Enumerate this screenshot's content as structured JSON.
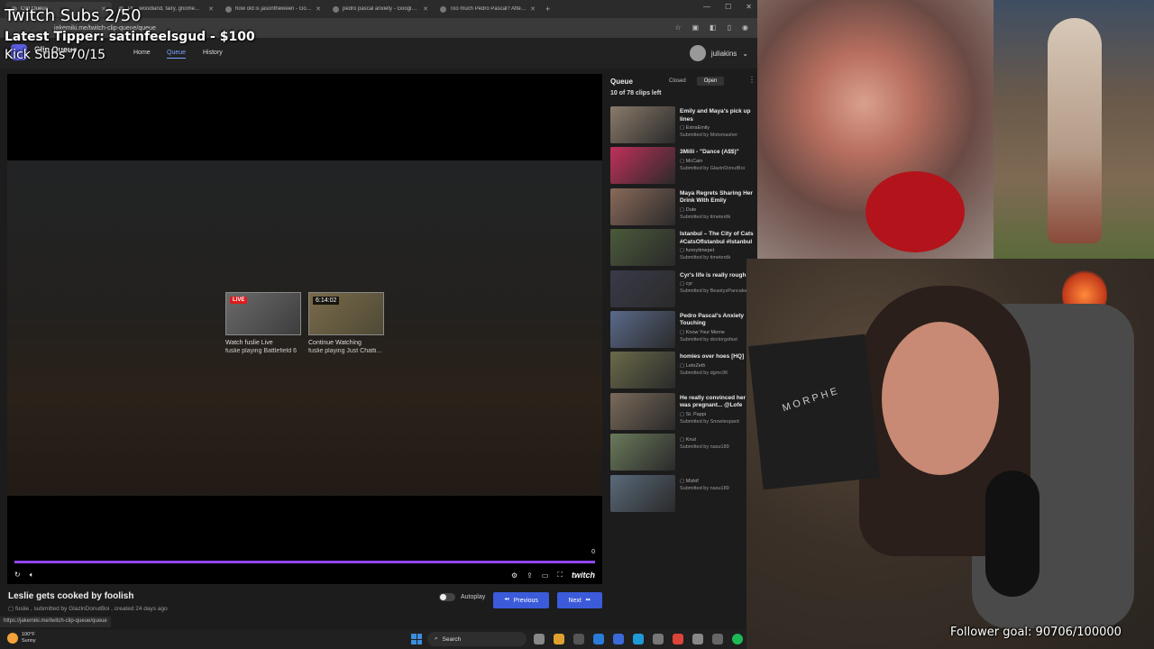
{
  "browser": {
    "tabs": [
      {
        "title": "Clip Queue",
        "active": true
      },
      {
        "title": "Pr... woodland, fairy, gnome...",
        "active": false
      },
      {
        "title": "how old is jasontheween - Goo...",
        "active": false
      },
      {
        "title": "pedro pascal anxiety - Google ...",
        "active": false
      },
      {
        "title": "Too much Pedro Pascal? After ...",
        "active": false
      }
    ],
    "new_tab": "+",
    "url": "jakemiki.me/twitch-clip-queue/queue"
  },
  "app": {
    "brand": "Clip Queue",
    "nav": {
      "home": "Home",
      "queue": "Queue",
      "history": "History"
    },
    "user": "juliakins"
  },
  "player": {
    "endcards": [
      {
        "badge": "LIVE",
        "title": "Watch fuslie Live",
        "subtitle": "fuslie playing Battlefield 6"
      },
      {
        "badge": "6:14:02",
        "title": "Continue Watching",
        "subtitle": "fuslie playing Just Chatti..."
      }
    ],
    "time": "0",
    "progress": 1.0,
    "brand": "twitch"
  },
  "clip": {
    "title": "Leslie gets cooked by foolish",
    "meta": "fuslie , submitted by GlazinDonutBoi , created 24 days ago"
  },
  "controls": {
    "autoplay": "Autoplay",
    "previous": "Previous",
    "next": "Next"
  },
  "status_url": "https://jakemiki.me/twitch-clip-queue/queue",
  "queue": {
    "heading": "Queue",
    "closed": "Closed",
    "open": "Open",
    "count": "10 of 78 clips left",
    "items": [
      {
        "title": "Emily and Maya's pick up lines",
        "channel": "ExtraEmily",
        "submitter": "Submitted by Motomasher",
        "color": "#8a7a6a"
      },
      {
        "title": "3Milli - \"Dance (A$$)\"",
        "channel": "McCain",
        "submitter": "Submitted by GlazinDonutBoi",
        "color": "#c0305a"
      },
      {
        "title": "Maya Regrets Sharing Her Drink With Emily",
        "channel": "Dute",
        "submitter": "Submitted by timeterdk",
        "color": "#8a6a5a"
      },
      {
        "title": "Istanbul – The City of Cats #CatsOfIstanbul #Istanbul",
        "channel": "funnytimepet",
        "submitter": "Submitted by timeterdk",
        "color": "#4a5a3a"
      },
      {
        "title": "Cyr's life is really rough",
        "channel": "cyr",
        "submitter": "Submitted by BeastyxPancakes",
        "color": "#3a3a4a"
      },
      {
        "title": "Pedro Pascal's Anxiety Touching",
        "channel": "Know Your Meme",
        "submitter": "Submitted by doctorgofast",
        "color": "#5a6a8a"
      },
      {
        "title": "homies over hoes [HQ]",
        "channel": "LetoZeth",
        "submitter": "Submitted by dgmc96",
        "color": "#6a6a4a"
      },
      {
        "title": "He really convinced her she was pregnant... @Lofe",
        "channel": "St. Pappi",
        "submitter": "Submitted by Snowleopard",
        "color": "#7a6a5a"
      },
      {
        "title": "",
        "channel": "Knut",
        "submitter": "Submitted by nasu189",
        "color": "#6a7a5a"
      },
      {
        "title": "",
        "channel": "Mizkif",
        "submitter": "Submitted by nasu189",
        "color": "#5a6a7a"
      }
    ]
  },
  "overlay": {
    "twitch_subs": "Twitch Subs 2/50",
    "latest_tipper": "Latest Tipper: satinfeelsgud - $100",
    "kick_subs": "Kick Subs 70/15",
    "follower_goal": "Follower goal: 90706/100000"
  },
  "webcam": {
    "book_text": "MORPHE"
  },
  "taskbar": {
    "temp": "100°F",
    "condition": "Sunny",
    "search": "Search"
  },
  "colors": {
    "accent": "#3b5bdb",
    "twitch_purple": "#9147ff",
    "live_red": "#e01b1b"
  }
}
